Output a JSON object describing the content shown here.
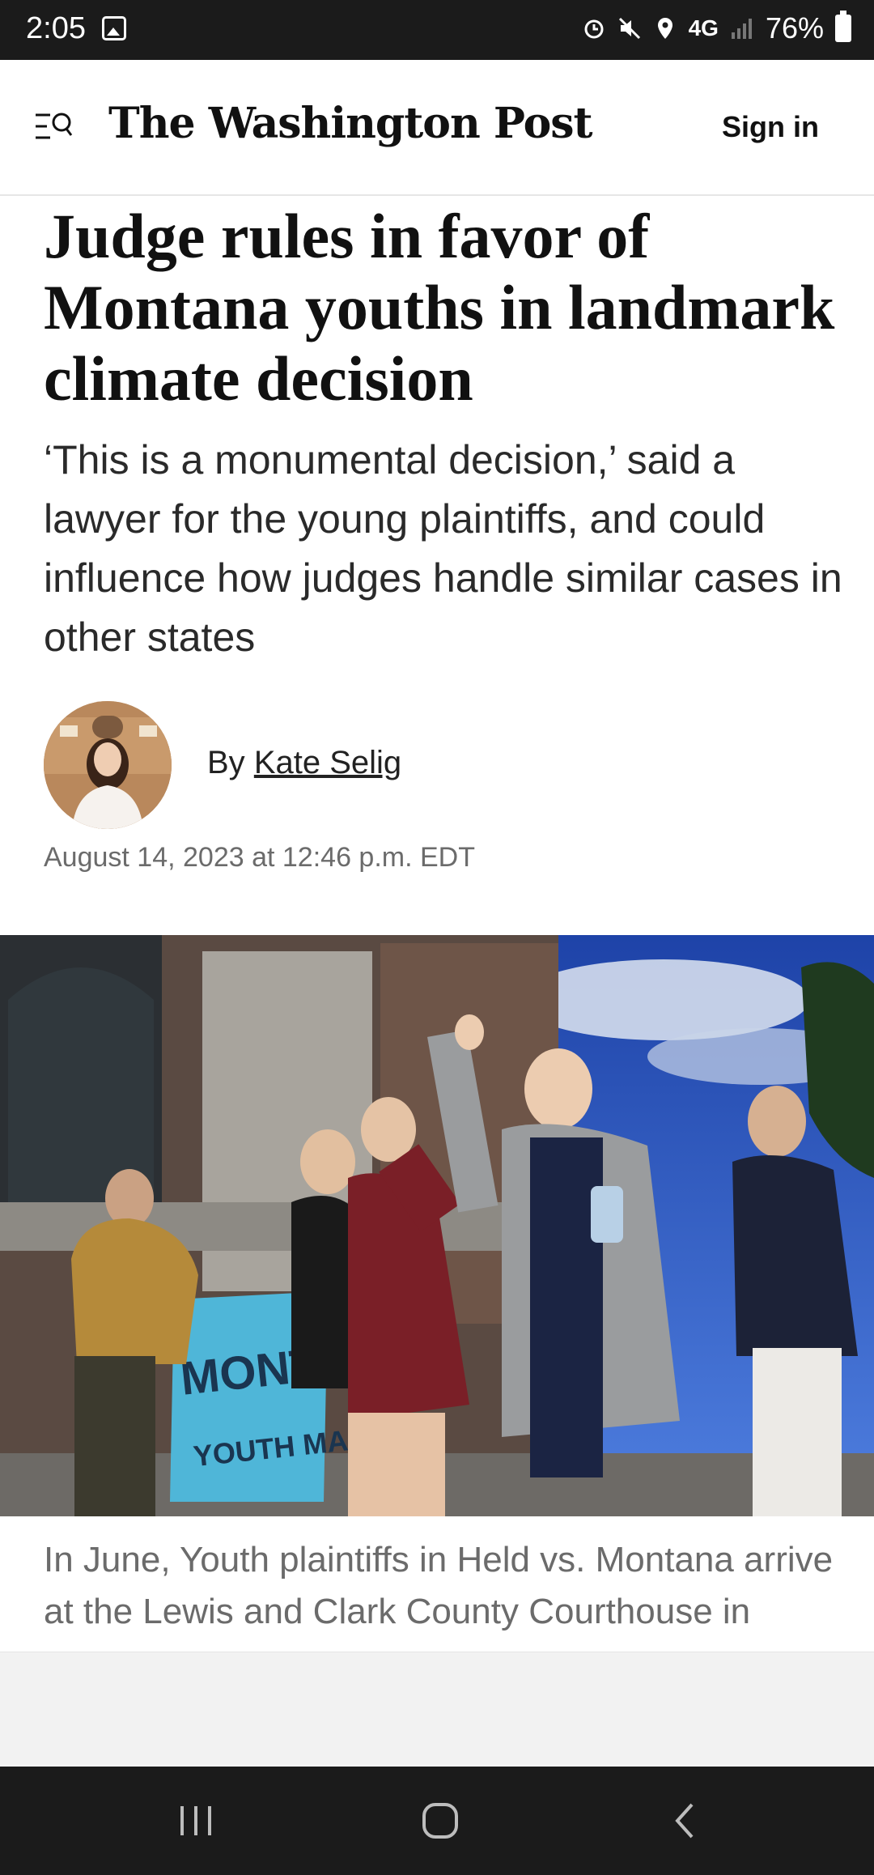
{
  "status_bar": {
    "time": "2:05",
    "network": "4G",
    "battery": "76%",
    "icons": [
      "gallery-icon",
      "alarm-icon",
      "mute-icon",
      "location-icon",
      "signal-icon",
      "battery-icon"
    ]
  },
  "header": {
    "brand": "The Washington Post",
    "sign_in": "Sign in",
    "menu_icon": "menu-search-icon"
  },
  "article": {
    "headline": "Judge rules in favor of Montana youths in landmark climate decision",
    "dek": "‘This is a monumental decision,’ said a lawyer for the young plaintiffs, and could influence how judges handle similar cases in other states",
    "byline_prefix": "By",
    "author": "Kate Selig",
    "date": "August 14, 2023 at 12:46 p.m. EDT",
    "photo_banner_line1": "MONTANA",
    "photo_banner_line2": "YOUTH MAKING",
    "caption": "In June, Youth plaintiffs in Held vs. Montana arrive at the Lewis and Clark County Courthouse in Helena, MT. A Montana court"
  },
  "nav_bar": {
    "icons": [
      "recents-icon",
      "home-icon",
      "back-icon"
    ]
  },
  "colors": {
    "status_bg": "#1b1b1b",
    "text_primary": "#111111",
    "text_secondary": "#6b6b6b",
    "banner_blue": "#4fb6d8",
    "sky_blue": "#2f5fc7"
  }
}
